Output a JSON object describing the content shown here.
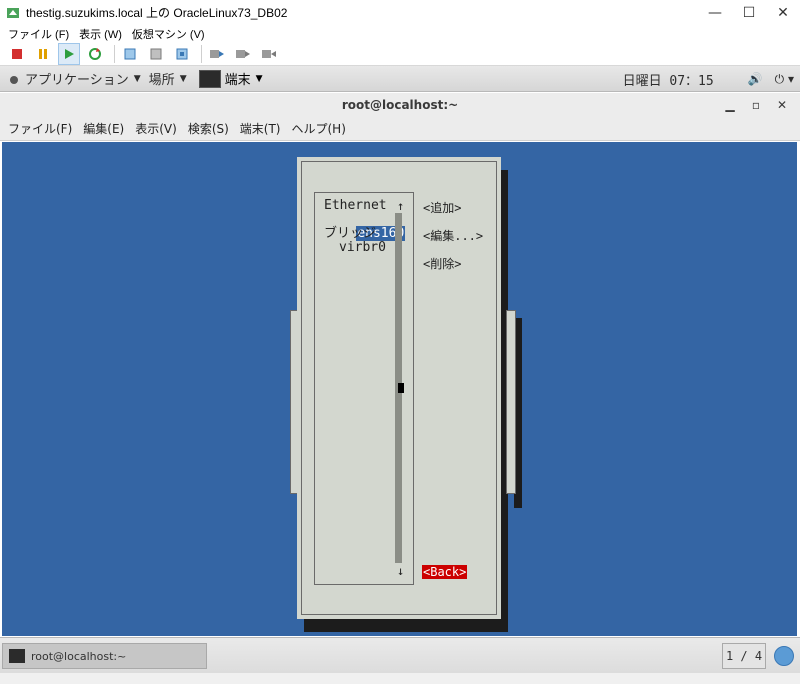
{
  "window": {
    "title": "thestig.suzukims.local 上の OracleLinux73_DB02",
    "minimize": "—",
    "maximize": "☐",
    "close": "✕"
  },
  "vm_menu": {
    "items": [
      "ファイル (F)",
      "表示 (W)",
      "仮想マシン (V)"
    ]
  },
  "gnome_bar": {
    "applications": "アプリケーション",
    "places": "場所",
    "terminal_task": "端末",
    "clock": "日曜日 07：15"
  },
  "terminal": {
    "title": "root@localhost:~",
    "menu": [
      "ファイル(F)",
      "編集(E)",
      "表示(V)",
      "検索(S)",
      "端末(T)",
      "ヘルプ(H)"
    ]
  },
  "nmtui": {
    "section_ethernet": "Ethernet",
    "conn_ens160": "ens160",
    "section_bridge": "ブリッジ",
    "conn_virbr0": "virbr0",
    "scroll_up": "↑",
    "scroll_down": "↓",
    "add": "<追加>",
    "edit": "<編集...>",
    "delete": "<削除>",
    "back": "<Back>"
  },
  "taskbar": {
    "item": "root@localhost:~",
    "workspace": "1 / 4"
  }
}
